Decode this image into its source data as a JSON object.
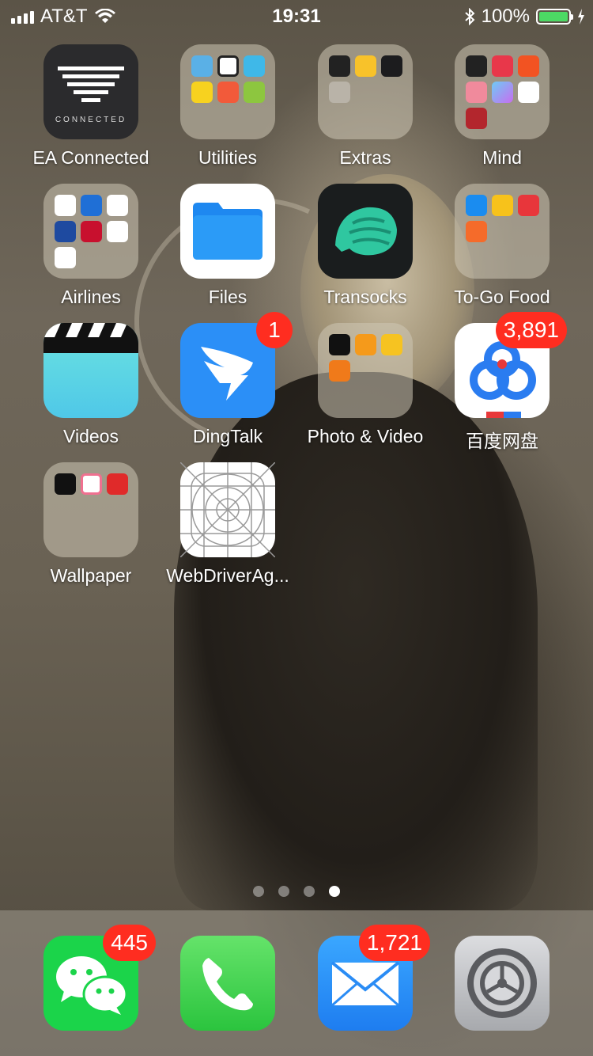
{
  "status_bar": {
    "carrier": "AT&T",
    "time": "19:31",
    "battery_percent": "100%",
    "battery_level": 1.0
  },
  "apps": [
    {
      "id": "ea-connected",
      "label": "EA Connected",
      "icon": "ea-connected-icon",
      "badge": null,
      "subtext": "CONNECTED"
    },
    {
      "id": "utilities-folder",
      "label": "Utilities",
      "icon": "folder-icon",
      "badge": null
    },
    {
      "id": "extras-folder",
      "label": "Extras",
      "icon": "folder-icon",
      "badge": null
    },
    {
      "id": "mind-folder",
      "label": "Mind",
      "icon": "folder-icon",
      "badge": null
    },
    {
      "id": "airlines-folder",
      "label": "Airlines",
      "icon": "folder-icon",
      "badge": null
    },
    {
      "id": "files",
      "label": "Files",
      "icon": "files-icon",
      "badge": null
    },
    {
      "id": "transocks",
      "label": "Transocks",
      "icon": "pangolin-icon",
      "badge": null
    },
    {
      "id": "to-go-food-folder",
      "label": "To-Go Food",
      "icon": "folder-icon",
      "badge": null
    },
    {
      "id": "videos",
      "label": "Videos",
      "icon": "clapperboard-icon",
      "badge": null
    },
    {
      "id": "dingtalk",
      "label": "DingTalk",
      "icon": "dingtalk-icon",
      "badge": "1"
    },
    {
      "id": "photo-video-folder",
      "label": "Photo & Video",
      "icon": "folder-icon",
      "badge": null
    },
    {
      "id": "baidu-pan",
      "label": "百度网盘",
      "icon": "baidu-cloud-icon",
      "badge": "3,891"
    },
    {
      "id": "wallpaper-folder",
      "label": "Wallpaper",
      "icon": "folder-icon",
      "badge": null
    },
    {
      "id": "webdriveragent",
      "label": "WebDriverAg...",
      "icon": "app-grid-template-icon",
      "badge": null
    }
  ],
  "page_indicator": {
    "total": 4,
    "current": 4
  },
  "dock": [
    {
      "id": "wechat",
      "icon": "wechat-icon",
      "badge": "445"
    },
    {
      "id": "phone",
      "icon": "phone-icon",
      "badge": null
    },
    {
      "id": "mail",
      "icon": "mail-icon",
      "badge": "1,721"
    },
    {
      "id": "settings",
      "icon": "settings-gear-icon",
      "badge": null
    }
  ],
  "colors": {
    "badge": "#ff2d20",
    "battery": "#4cd964",
    "folder_bg": "#cdc6b4"
  }
}
